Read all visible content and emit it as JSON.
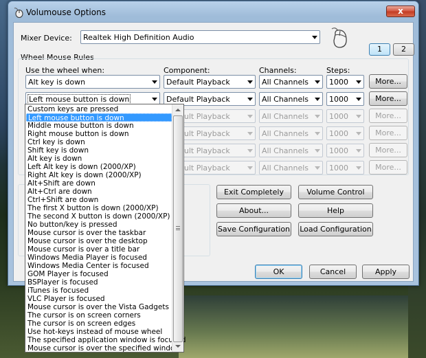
{
  "window": {
    "title": "Volumouse Options",
    "close_label": "x"
  },
  "mixer": {
    "label": "Mixer Device:",
    "value": "Realtek High Definition Audio"
  },
  "pages": [
    "1",
    "2"
  ],
  "rules": {
    "group_label": "Wheel Mouse Rules",
    "headers": {
      "use": "Use the wheel when:",
      "component": "Component:",
      "channels": "Channels:",
      "steps": "Steps:"
    },
    "more_label": "More...",
    "rows": [
      {
        "use": "Alt key is down",
        "component": "Default Playback",
        "channels": "All Channels",
        "steps": "1000",
        "enabled": true
      },
      {
        "use": "Left mouse button is down",
        "component": "Default Playback",
        "channels": "All Channels",
        "steps": "1000",
        "enabled": true
      },
      {
        "use": "",
        "component": "Default Playback",
        "channels": "All Channels",
        "steps": "1000",
        "enabled": false
      },
      {
        "use": "",
        "component": "Default Playback",
        "channels": "All Channels",
        "steps": "1000",
        "enabled": false
      },
      {
        "use": "",
        "component": "Default Playback",
        "channels": "All Channels",
        "steps": "1000",
        "enabled": false
      },
      {
        "use": "",
        "component": "Default Playback",
        "channels": "All Channels",
        "steps": "1000",
        "enabled": false
      }
    ]
  },
  "buttons": {
    "exit": "Exit Completely",
    "volume": "Volume Control",
    "about": "About...",
    "help": "Help",
    "save": "Save Configuration",
    "load": "Load Configuration",
    "ok": "OK",
    "cancel": "Cancel",
    "apply": "Apply"
  },
  "dropdown_options": [
    "Custom keys are pressed",
    "Left mouse button is down",
    "Middle mouse button is down",
    "Right mouse button is down",
    "Ctrl key is down",
    "Shift key is down",
    "Alt key is down",
    "Left Alt key is down  (2000/XP)",
    "Right Alt key is down  (2000/XP)",
    "Alt+Shift are down",
    "Alt+Ctrl are down",
    "Ctrl+Shift are down",
    "The first X button is down  (2000/XP)",
    "The second X button is down  (2000/XP)",
    "No button/key is pressed",
    "Mouse cursor is over the taskbar",
    "Mouse cursor is over the desktop",
    "Mouse cursor is over a title bar",
    "Windows Media Player is focused",
    "Windows Media Center is focused",
    "GOM Player is focused",
    "BSPlayer is focused",
    "iTunes is focused",
    "VLC Player is focused",
    "Mouse cursor is over the Vista Gadgets",
    "The cursor is on screen corners",
    "The cursor is on screen edges",
    "Use hot-keys instead of mouse wheel",
    "The specified application window is focused",
    "Mouse cursor is over the specified window"
  ],
  "dropdown_selected_index": 1
}
